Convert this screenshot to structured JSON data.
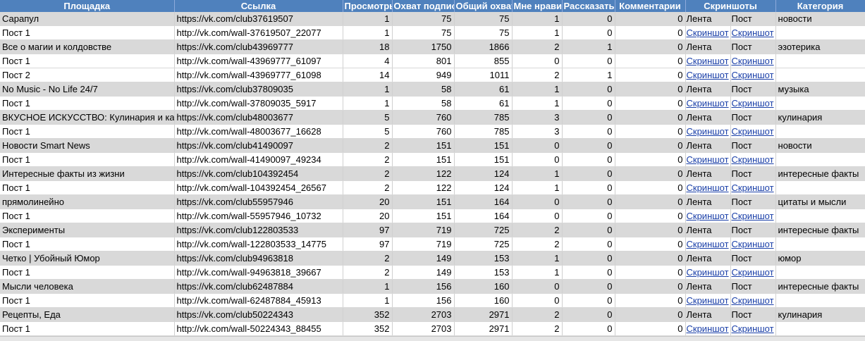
{
  "headers": [
    "Площадка",
    "Ссылка",
    "Просмотры",
    "Охват подписчиков",
    "Общий охват",
    "Мне нравится",
    "Рассказать друзьям",
    "Комментарии",
    "Скриншоты",
    "",
    "Категория"
  ],
  "rows": [
    {
      "kind": "group",
      "cells": [
        "Сарапул",
        "https://vk.com/club37619507",
        "1",
        "75",
        "75",
        "1",
        "0",
        "0",
        "Лента",
        "Пост",
        "новости"
      ]
    },
    {
      "kind": "post",
      "cells": [
        "Пост 1",
        "http://vk.com/wall-37619507_22077",
        "1",
        "75",
        "75",
        "1",
        "0",
        "0",
        "Скриншот",
        "Скриншот",
        ""
      ]
    },
    {
      "kind": "group",
      "cells": [
        "Все о магии и колдовстве",
        "https://vk.com/club43969777",
        "18",
        "1750",
        "1866",
        "2",
        "1",
        "0",
        "Лента",
        "Пост",
        "эзотерика"
      ]
    },
    {
      "kind": "post",
      "cells": [
        "Пост 1",
        "http://vk.com/wall-43969777_61097",
        "4",
        "801",
        "855",
        "0",
        "0",
        "0",
        "Скриншот",
        "Скриншот",
        ""
      ]
    },
    {
      "kind": "post",
      "cells": [
        "Пост 2",
        "http://vk.com/wall-43969777_61098",
        "14",
        "949",
        "1011",
        "2",
        "1",
        "0",
        "Скриншот",
        "Скриншот",
        ""
      ]
    },
    {
      "kind": "group",
      "cells": [
        "No Music - No Life 24/7",
        "https://vk.com/club37809035",
        "1",
        "58",
        "61",
        "1",
        "0",
        "0",
        "Лента",
        "Пост",
        "музыка"
      ]
    },
    {
      "kind": "post",
      "cells": [
        "Пост 1",
        "http://vk.com/wall-37809035_5917",
        "1",
        "58",
        "61",
        "1",
        "0",
        "0",
        "Скриншот",
        "Скриншот",
        ""
      ]
    },
    {
      "kind": "group",
      "cells": [
        "ВКУСНОЕ ИСКУССТВО: Кулинария и кар",
        "https://vk.com/club48003677",
        "5",
        "760",
        "785",
        "3",
        "0",
        "0",
        "Лента",
        "Пост",
        "кулинария"
      ]
    },
    {
      "kind": "post",
      "cells": [
        "Пост 1",
        "http://vk.com/wall-48003677_16628",
        "5",
        "760",
        "785",
        "3",
        "0",
        "0",
        "Скриншот",
        "Скриншот",
        ""
      ]
    },
    {
      "kind": "group",
      "cells": [
        "Новости Smart News",
        "https://vk.com/club41490097",
        "2",
        "151",
        "151",
        "0",
        "0",
        "0",
        "Лента",
        "Пост",
        "новости"
      ]
    },
    {
      "kind": "post",
      "cells": [
        "Пост 1",
        "http://vk.com/wall-41490097_49234",
        "2",
        "151",
        "151",
        "0",
        "0",
        "0",
        "Скриншот",
        "Скриншот",
        ""
      ]
    },
    {
      "kind": "group",
      "cells": [
        "Интересные факты из жизни",
        "https://vk.com/club104392454",
        "2",
        "122",
        "124",
        "1",
        "0",
        "0",
        "Лента",
        "Пост",
        "интересные факты"
      ]
    },
    {
      "kind": "post",
      "cells": [
        "Пост 1",
        "http://vk.com/wall-104392454_26567",
        "2",
        "122",
        "124",
        "1",
        "0",
        "0",
        "Скриншот",
        "Скриншот",
        ""
      ]
    },
    {
      "kind": "group",
      "cells": [
        "прямолинейно",
        "https://vk.com/club55957946",
        "20",
        "151",
        "164",
        "0",
        "0",
        "0",
        "Лента",
        "Пост",
        "цитаты и мысли"
      ]
    },
    {
      "kind": "post",
      "cells": [
        "Пост 1",
        "http://vk.com/wall-55957946_10732",
        "20",
        "151",
        "164",
        "0",
        "0",
        "0",
        "Скриншот",
        "Скриншот",
        ""
      ]
    },
    {
      "kind": "group",
      "cells": [
        "Эксперименты",
        "https://vk.com/club122803533",
        "97",
        "719",
        "725",
        "2",
        "0",
        "0",
        "Лента",
        "Пост",
        "интересные факты"
      ]
    },
    {
      "kind": "post",
      "cells": [
        "Пост 1",
        "http://vk.com/wall-122803533_14775",
        "97",
        "719",
        "725",
        "2",
        "0",
        "0",
        "Скриншот",
        "Скриншот",
        ""
      ]
    },
    {
      "kind": "group",
      "cells": [
        "Четко | Убойный Юмор",
        "https://vk.com/club94963818",
        "2",
        "149",
        "153",
        "1",
        "0",
        "0",
        "Лента",
        "Пост",
        "юмор"
      ]
    },
    {
      "kind": "post",
      "cells": [
        "Пост 1",
        "http://vk.com/wall-94963818_39667",
        "2",
        "149",
        "153",
        "1",
        "0",
        "0",
        "Скриншот",
        "Скриншот",
        ""
      ]
    },
    {
      "kind": "group",
      "cells": [
        "Мысли человека",
        "https://vk.com/club62487884",
        "1",
        "156",
        "160",
        "0",
        "0",
        "0",
        "Лента",
        "Пост",
        "интересные факты"
      ]
    },
    {
      "kind": "post",
      "cells": [
        "Пост 1",
        "http://vk.com/wall-62487884_45913",
        "1",
        "156",
        "160",
        "0",
        "0",
        "0",
        "Скриншот",
        "Скриншот",
        ""
      ]
    },
    {
      "kind": "group",
      "cells": [
        "Рецепты, Еда",
        "https://vk.com/club50224343",
        "352",
        "2703",
        "2971",
        "2",
        "0",
        "0",
        "Лента",
        "Пост",
        "кулинария"
      ]
    },
    {
      "kind": "post",
      "cells": [
        "Пост 1",
        "http://vk.com/wall-50224343_88455",
        "352",
        "2703",
        "2971",
        "2",
        "0",
        "0",
        "Скриншот",
        "Скриншот",
        ""
      ]
    }
  ],
  "colors": {
    "header_bg": "#4f81bd",
    "group_row_bg": "#d9d9d9",
    "link": "#1a3fa8"
  }
}
